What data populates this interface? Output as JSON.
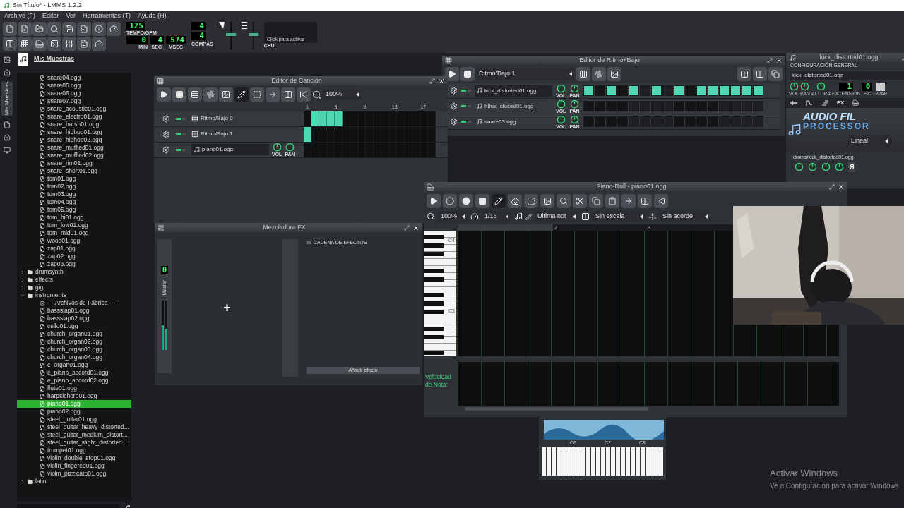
{
  "window": {
    "title": "Sin Título* - LMMS 1.2.2"
  },
  "menu": [
    "Archivo (F)",
    "Editar",
    "Ver",
    "Herramientas (T)",
    "Ayuda (H)"
  ],
  "toolbar": {
    "tempo": "125",
    "tempo_label": "TEMPO/GPM",
    "min": "0",
    "sec": "4",
    "msec": "574",
    "min_label": "MIN",
    "sec_label": "SEG",
    "msec_label": "MSEG",
    "sig_num": "4",
    "sig_den": "4",
    "sig_label": "COMPÁS",
    "cpu_hint": "Click para activar",
    "cpu_label": "CPU",
    "volume": {
      "level": 0.55
    },
    "pitch": {
      "level": 0.55
    }
  },
  "sidebar": {
    "tab": "Mis Muestras",
    "selected": true
  },
  "file_browser": {
    "title": "Mis Muestras",
    "files_above": [
      {
        "name": "snare04.ogg",
        "selected": false
      },
      {
        "name": "snare05.ogg",
        "selected": false
      },
      {
        "name": "snare06.ogg",
        "selected": false
      },
      {
        "name": "snare07.ogg",
        "selected": false
      },
      {
        "name": "snare_acoustic01.ogg",
        "selected": false
      },
      {
        "name": "snare_electro01.ogg",
        "selected": false
      },
      {
        "name": "snare_harsh01.ogg",
        "selected": false
      },
      {
        "name": "snare_hiphop01.ogg",
        "selected": false
      },
      {
        "name": "snare_hiphop02.ogg",
        "selected": false
      },
      {
        "name": "snare_muffled01.ogg",
        "selected": false
      },
      {
        "name": "snare_muffled02.ogg",
        "selected": false
      },
      {
        "name": "snare_rim01.ogg",
        "selected": false
      },
      {
        "name": "snare_short01.ogg",
        "selected": false
      },
      {
        "name": "tom01.ogg",
        "selected": false
      },
      {
        "name": "tom02.ogg",
        "selected": false
      },
      {
        "name": "tom03.ogg",
        "selected": false
      },
      {
        "name": "tom04.ogg",
        "selected": false
      },
      {
        "name": "tom05.ogg",
        "selected": false
      },
      {
        "name": "tom_hi01.ogg",
        "selected": false
      },
      {
        "name": "tom_low01.ogg",
        "selected": false
      },
      {
        "name": "tom_mid01.ogg",
        "selected": false
      },
      {
        "name": "wood01.ogg",
        "selected": false
      },
      {
        "name": "zap01.ogg",
        "selected": false
      },
      {
        "name": "zap02.ogg",
        "selected": false
      },
      {
        "name": "zap03.ogg",
        "selected": false
      }
    ],
    "folders": [
      {
        "name": "drumsynth",
        "expanded": false
      },
      {
        "name": "effects",
        "expanded": false
      },
      {
        "name": "gig",
        "expanded": false
      },
      {
        "name": "instruments",
        "expanded": true,
        "children": [
          {
            "kind": "label",
            "name": "--- Archivos de Fábrica ---",
            "selected": false
          },
          {
            "kind": "file",
            "name": "bassslap01.ogg",
            "selected": false
          },
          {
            "kind": "file",
            "name": "bassslap02.ogg",
            "selected": false
          },
          {
            "kind": "file",
            "name": "cello01.ogg",
            "selected": false
          },
          {
            "kind": "file",
            "name": "church_organ01.ogg",
            "selected": false
          },
          {
            "kind": "file",
            "name": "church_organ02.ogg",
            "selected": false
          },
          {
            "kind": "file",
            "name": "church_organ03.ogg",
            "selected": false
          },
          {
            "kind": "file",
            "name": "church_organ04.ogg",
            "selected": false
          },
          {
            "kind": "file",
            "name": "e_organ01.ogg",
            "selected": false
          },
          {
            "kind": "file",
            "name": "e_piano_accord01.ogg",
            "selected": false
          },
          {
            "kind": "file",
            "name": "e_piano_accord02.ogg",
            "selected": false
          },
          {
            "kind": "file",
            "name": "flute01.ogg",
            "selected": false
          },
          {
            "kind": "file",
            "name": "harpsichord01.ogg",
            "selected": false
          },
          {
            "kind": "file",
            "name": "piano01.ogg",
            "selected": true
          },
          {
            "kind": "file",
            "name": "piano02.ogg",
            "selected": false
          },
          {
            "kind": "file",
            "name": "steel_guitar01.ogg",
            "selected": false
          },
          {
            "kind": "file",
            "name": "steel_guitar_heavy_distorted...",
            "selected": false
          },
          {
            "kind": "file",
            "name": "steel_guitar_medium_distort...",
            "selected": false
          },
          {
            "kind": "file",
            "name": "steel_guitar_slight_distorted...",
            "selected": false
          },
          {
            "kind": "file",
            "name": "trumpet01.ogg",
            "selected": false
          },
          {
            "kind": "file",
            "name": "violin_double_stop01.ogg",
            "selected": false
          },
          {
            "kind": "file",
            "name": "violin_fingered01.ogg",
            "selected": false
          },
          {
            "kind": "file",
            "name": "violin_pizzicato01.ogg",
            "selected": false
          }
        ]
      },
      {
        "name": "latin",
        "expanded": false
      }
    ]
  },
  "song_editor": {
    "title": "Editor de Canción",
    "zoom": "100%",
    "ruler": [
      "1",
      "5",
      "9",
      "13",
      "17"
    ],
    "tracks": [
      {
        "kind": "beat",
        "name": "Ritmo/Bajo 0",
        "cells": [
          false,
          true,
          true,
          true,
          true,
          false,
          false,
          false,
          false,
          false,
          false,
          false,
          false,
          false,
          false,
          false,
          false
        ]
      },
      {
        "kind": "beat",
        "name": "Ritmo/Bajo 1",
        "cells": [
          true,
          false,
          false,
          false,
          false,
          false,
          false,
          false,
          false,
          false,
          false,
          false,
          false,
          false,
          false,
          false,
          false
        ]
      },
      {
        "kind": "instrument",
        "name": "piano01.ogg",
        "vol": "VOL",
        "pan": "PAN",
        "cells": [
          false,
          false,
          false,
          false,
          false,
          false,
          false,
          false,
          false,
          false,
          false,
          false,
          false,
          false,
          false,
          false,
          false
        ]
      }
    ]
  },
  "beat_editor": {
    "title": "Editor de Ritmo+Bajo",
    "pattern": "Ritmo/Bajo 1",
    "tracks": [
      {
        "name": "kick_distorted01.ogg",
        "vol": "VOL",
        "pan": "PAN",
        "steps": [
          true,
          false,
          true,
          false,
          true,
          false,
          true,
          false,
          true,
          false,
          true,
          true,
          true,
          true,
          true,
          true
        ]
      },
      {
        "name": "hihat_closed01.ogg",
        "vol": "VOL",
        "pan": "PAN",
        "steps": [
          false,
          false,
          false,
          false,
          false,
          false,
          false,
          false,
          false,
          false,
          false,
          false,
          false,
          false,
          false,
          false
        ]
      },
      {
        "name": "snare03.ogg",
        "vol": "VOL",
        "pan": "PAN",
        "steps": [
          false,
          false,
          false,
          false,
          false,
          false,
          false,
          false,
          false,
          false,
          false,
          false,
          false,
          false,
          false,
          false
        ]
      }
    ]
  },
  "mixer": {
    "title": "Mezcladora FX",
    "channel_value": "0",
    "channel": "Master",
    "add": "+",
    "chain": "CADENA DE EFECTOS",
    "add_effect": "Añadir efecto"
  },
  "piano_roll": {
    "title": "Piano-Roll - piano01.ogg",
    "zoom": "100%",
    "quantize": "1/16",
    "note_length": "Ultima not",
    "scale": "Sin escala",
    "chord": "Sin acorde",
    "ruler": [
      "2",
      "3"
    ],
    "keys": [
      "C4",
      "C3"
    ],
    "velocity_label": "Velocidad de Nota:"
  },
  "instrument": {
    "title": "kick_distorted01.ogg",
    "section": "CONFIGURACIÓN GENERAL",
    "name": "kick_distorted01.ogg",
    "knobs": [
      "VOL",
      "PAN",
      "ALTURA"
    ],
    "range_label": "EXTENSIÓN",
    "range_value": "1",
    "fx_label": "FX",
    "fx_value": "0",
    "save_label": "GUAR",
    "tabs": [
      {
        "label": "FX",
        "selected": false
      }
    ],
    "logo_top": "AUDIO FIL",
    "logo_bottom": "PROCESSOR",
    "interpolation": "Lineal",
    "path": "drums/kick_distorted01.ogg",
    "rev": "Я"
  },
  "mini_piano": {
    "octaves": [
      "C6",
      "C7",
      "C8"
    ]
  },
  "activation": {
    "title": "Activar Windows",
    "text": "Ve a Configuración para activar Windows"
  }
}
